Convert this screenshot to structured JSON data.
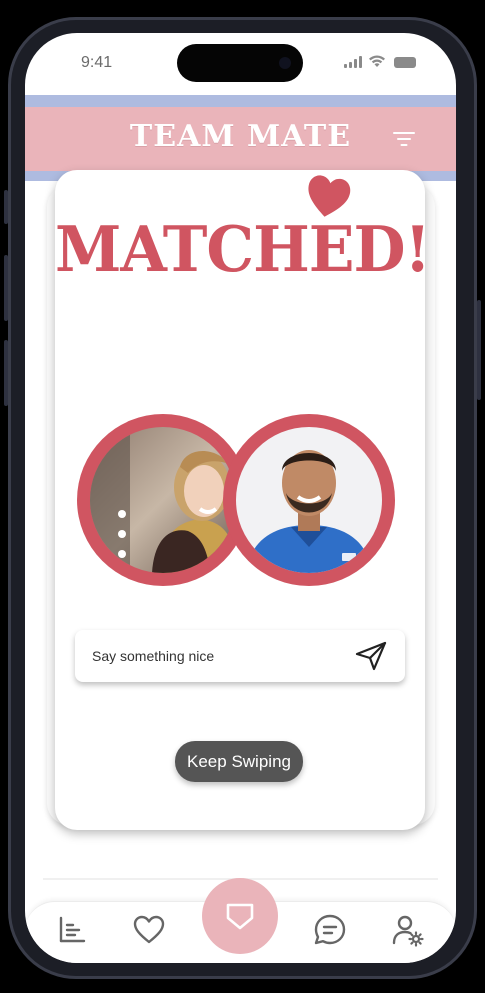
{
  "status_bar": {
    "time": "9:41"
  },
  "header": {
    "app_title": "TEAM MATE"
  },
  "match": {
    "title": "MATCHED!",
    "message_placeholder": "Say something nice",
    "keep_swiping_label": "Keep Swiping"
  },
  "bottom_nav": {
    "items": [
      "leaderboard-icon",
      "heart-icon",
      "shield-icon",
      "chat-icon",
      "user-settings-icon"
    ]
  },
  "colors": {
    "accent": "#d05561",
    "header_pink": "#eab4ba",
    "header_blue": "#aebbe0",
    "button_dark": "#555555"
  }
}
